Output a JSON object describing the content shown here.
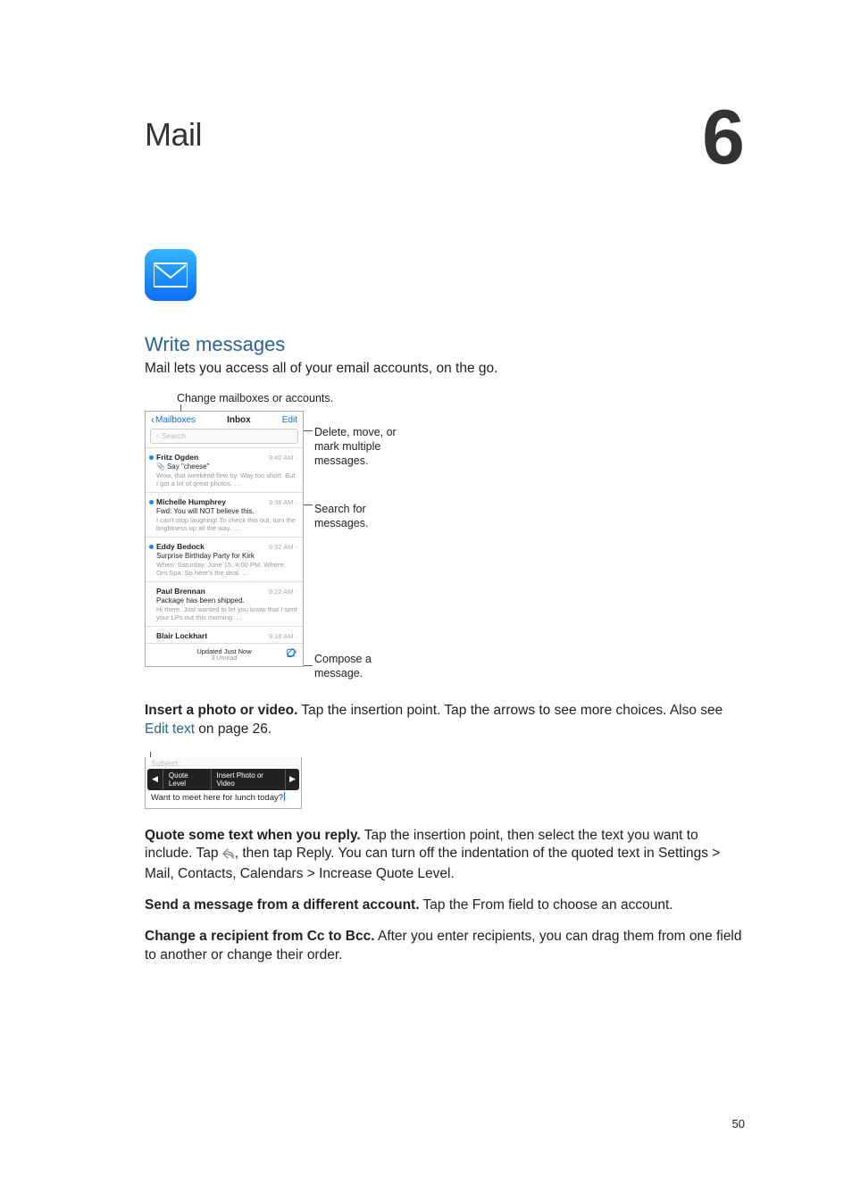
{
  "chapter": {
    "title": "Mail",
    "number": "6"
  },
  "section": {
    "title": "Write messages",
    "intro": "Mail lets you access all of your email accounts, on the go."
  },
  "figure1": {
    "callouts": {
      "top": "Change mailboxes or accounts.",
      "right1": "Delete, move, or mark multiple messages.",
      "right2": "Search for messages.",
      "right3": "Compose a message."
    },
    "inbox": {
      "back": "Mailboxes",
      "title": "Inbox",
      "edit": "Edit",
      "search_placeholder": "Search",
      "footer_line1": "Updated Just Now",
      "footer_line2": "3 Unread",
      "messages": [
        {
          "sender": "Fritz Ogden",
          "time": "9:40 AM",
          "subject": "Say \"cheese\"",
          "preview": "Wow, that weekend flew by. Way too short. But I got a lot of great photos. …",
          "unread": true,
          "attachment": true
        },
        {
          "sender": "Michelle Humphrey",
          "time": "9:38 AM",
          "subject": "Fwd: You will NOT believe this.",
          "preview": "I can't stop laughing! To check this out, turn the brightness up all the way, …",
          "unread": true,
          "attachment": false
        },
        {
          "sender": "Eddy Bedock",
          "time": "9:32 AM",
          "subject": "Surprise Birthday Party for Kirk",
          "preview": "When: Saturday, June 15, 4:00 PM. Where: Om Spa. So here's the deal. …",
          "unread": true,
          "attachment": false
        },
        {
          "sender": "Paul Brennan",
          "time": "9:22 AM",
          "subject": "Package has been shipped.",
          "preview": "Hi there. Just wanted to let you know that I sent your LPs out this morning. …",
          "unread": false,
          "attachment": false
        },
        {
          "sender": "Blair Lockhart",
          "time": "9:18 AM",
          "subject": "",
          "preview": "",
          "unread": false,
          "attachment": false
        }
      ]
    }
  },
  "para_insert": {
    "bold": "Insert a photo or video.",
    "text": " Tap the insertion point. Tap the arrows to see more choices. Also see ",
    "link": "Edit text",
    "tail": " on page 26."
  },
  "figure2": {
    "subject_label": "Subject:",
    "menu": {
      "left_arrow": "◀",
      "quote": "Quote Level",
      "insert": "Insert Photo or Video",
      "right_arrow": "▶"
    },
    "body": "Want to meet here for lunch today?"
  },
  "para_quote": {
    "bold": "Quote some text when you reply.",
    "text": " Tap the insertion point, then select the text you want to include. Tap ",
    "tail": ", then tap Reply. You can turn off the indentation of the quoted text in Settings > Mail, Contacts, Calendars > Increase Quote Level."
  },
  "para_account": {
    "bold": "Send a message from a different account.",
    "text": " Tap the From field to choose an account."
  },
  "para_ccbcc": {
    "bold": "Change a recipient from Cc to Bcc.",
    "text": " After you enter recipients, you can drag them from one field to another or change their order."
  },
  "page_number": "50"
}
